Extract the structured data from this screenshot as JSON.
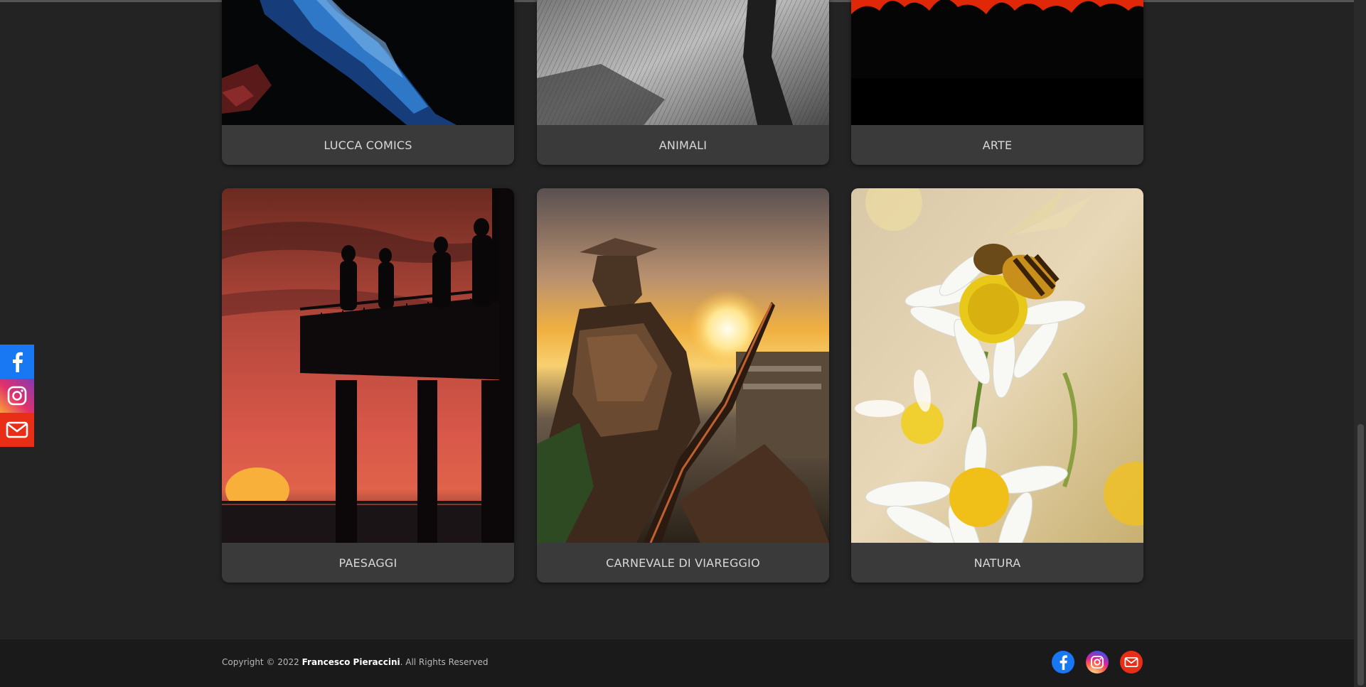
{
  "gallery": {
    "cards": [
      {
        "label": "LUCCA COMICS"
      },
      {
        "label": "ANIMALI"
      },
      {
        "label": "ARTE"
      },
      {
        "label": "PAESAGGI"
      },
      {
        "label": "CARNEVALE DI VIAREGGIO"
      },
      {
        "label": "NATURA"
      }
    ]
  },
  "side_social": {
    "icons": [
      "facebook-icon",
      "instagram-icon",
      "mail-icon"
    ]
  },
  "footer": {
    "copyright_prefix": "Copyright © 2022 ",
    "copyright_name": "Francesco Pieraccini",
    "copyright_suffix": ". All Rights Reserved",
    "icons": [
      "facebook-icon",
      "instagram-icon",
      "mail-icon"
    ]
  },
  "colors": {
    "background": "#232323",
    "card": "#3a3a3a",
    "footer": "#1a1a1a",
    "facebook": "#1877f2",
    "mail": "#e82e16"
  }
}
